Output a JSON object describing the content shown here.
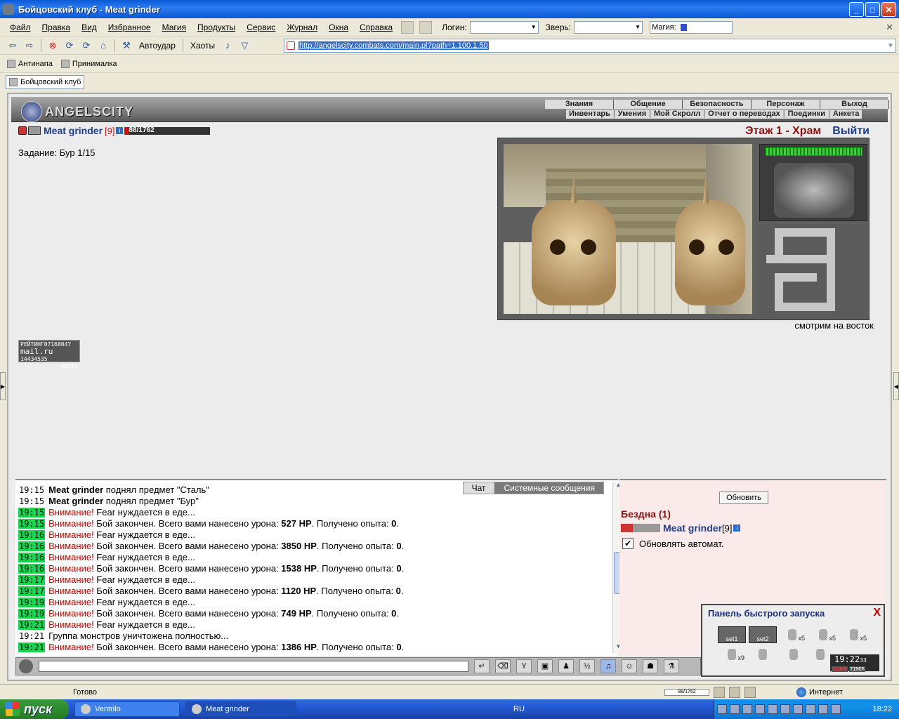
{
  "window": {
    "title": "Бойцовский клуб - Meat grinder",
    "min": "_",
    "max": "□",
    "close": "✕"
  },
  "menu": {
    "items": [
      "Файл",
      "Правка",
      "Вид",
      "Избранное",
      "Магия",
      "Продукты",
      "Сервис",
      "Журнал",
      "Окна",
      "Справка"
    ],
    "login_label": "Логин:",
    "beast_label": "Зверь:",
    "magic_label": "Магия:",
    "close_glyph": "✕"
  },
  "toolbar": {
    "autohit_label": "Автоудар",
    "chaos_label": "Хаоты",
    "url": "http://angelscity.combats.com/main.pl?path=1.100.1.50"
  },
  "links": [
    "Антинапа",
    "Принималка"
  ],
  "tab": {
    "label": "Бойцовский клуб"
  },
  "game": {
    "logo_text": "ANGELSCITY",
    "nav_top": [
      "Знания",
      "Общение",
      "Безопасность",
      "Персонаж",
      "Выход"
    ],
    "nav_bottom": [
      "Инвентарь",
      "Умения",
      "Мой Скролл",
      "Отчет о переводах",
      "Поединки",
      "Анкета"
    ],
    "player": {
      "name": "Meat grinder",
      "level": "[9]",
      "hp_text": "88/1762",
      "hp_fraction": 0.05,
      "info": "i"
    },
    "task": "Задание: Бур 1/15",
    "floor": "Этаж 1 - Храм",
    "exit": "Выйти",
    "facing": "смотрим на восток",
    "rating": {
      "line1": "РЕЙТИНГ",
      "line1b": "07168047",
      "brand": "mail.ru",
      "line2": "14434535",
      "line3": "48194"
    }
  },
  "chat": {
    "tab_chat": "Чат",
    "tab_system": "Системные сообщения",
    "lines": [
      {
        "time": "19:15",
        "hl": false,
        "who": "Meat grinder",
        "text": " поднял предмет \"Сталь\""
      },
      {
        "time": "19:15",
        "hl": false,
        "who": "Meat grinder",
        "text": " поднял предмет \"Бур\""
      },
      {
        "time": "19:15",
        "hl": true,
        "warn": "Внимание!",
        "text": " Fear нуждается в еде..."
      },
      {
        "time": "19:15",
        "hl": true,
        "warn": "Внимание!",
        "text": " Бой закончен. Всего вами нанесено урона: ",
        "dmg": "527 HP",
        "tail": ". Получено опыта: ",
        "exp": "0",
        "end": "."
      },
      {
        "time": "19:16",
        "hl": true,
        "warn": "Внимание!",
        "text": " Fear нуждается в еде..."
      },
      {
        "time": "19:16",
        "hl": true,
        "warn": "Внимание!",
        "text": " Бой закончен. Всего вами нанесено урона: ",
        "dmg": "3850 HP",
        "tail": ". Получено опыта: ",
        "exp": "0",
        "end": "."
      },
      {
        "time": "19:16",
        "hl": true,
        "warn": "Внимание!",
        "text": " Fear нуждается в еде..."
      },
      {
        "time": "19:16",
        "hl": true,
        "warn": "Внимание!",
        "text": " Бой закончен. Всего вами нанесено урона: ",
        "dmg": "1538 HP",
        "tail": ". Получено опыта: ",
        "exp": "0",
        "end": "."
      },
      {
        "time": "19:17",
        "hl": true,
        "warn": "Внимание!",
        "text": " Fear нуждается в еде..."
      },
      {
        "time": "19:17",
        "hl": true,
        "warn": "Внимание!",
        "text": " Бой закончен. Всего вами нанесено урона: ",
        "dmg": "1120 HP",
        "tail": ". Получено опыта: ",
        "exp": "0",
        "end": "."
      },
      {
        "time": "19:19",
        "hl": true,
        "warn": "Внимание!",
        "text": " Fear нуждается в еде..."
      },
      {
        "time": "19:19",
        "hl": true,
        "warn": "Внимание!",
        "text": " Бой закончен. Всего вами нанесено урона: ",
        "dmg": "749 HP",
        "tail": ". Получено опыта: ",
        "exp": "0",
        "end": "."
      },
      {
        "time": "19:21",
        "hl": true,
        "warn": "Внимание!",
        "text": " Fear нуждается в еде..."
      },
      {
        "time": "19:21",
        "hl": false,
        "text": "Группа монстров уничтожена полностью..."
      },
      {
        "time": "19:21",
        "hl": true,
        "warn": "Внимание!",
        "text": " Бой закончен. Всего вами нанесено урона: ",
        "dmg": "1386 HP",
        "tail": ". Получено опыта: ",
        "exp": "0",
        "end": "."
      }
    ]
  },
  "online": {
    "refresh": "Обновить",
    "room": "Бездна (1)",
    "user": {
      "name": "Meat grinder",
      "level": "[9]",
      "info": "i"
    },
    "auto_refresh": "Обновлять автомат.",
    "auto_checked": true
  },
  "quick_launch": {
    "title": "Панель быстрого запуска",
    "close": "X",
    "slots": [
      "set1",
      "set2"
    ],
    "potions": [
      "x5",
      "x5",
      "x5",
      "x9"
    ],
    "time": "19:22",
    "seconds": "33",
    "clock_label": "CLOCK",
    "timer_label": "TIMER"
  },
  "statusbar": {
    "text": "Готово",
    "hp": "88/1762",
    "zone": "Интернет"
  },
  "taskbar": {
    "start": "пуск",
    "tasks": [
      "Ventrilo",
      "Meat grinder"
    ],
    "lang": "RU",
    "clock": "18:22"
  }
}
